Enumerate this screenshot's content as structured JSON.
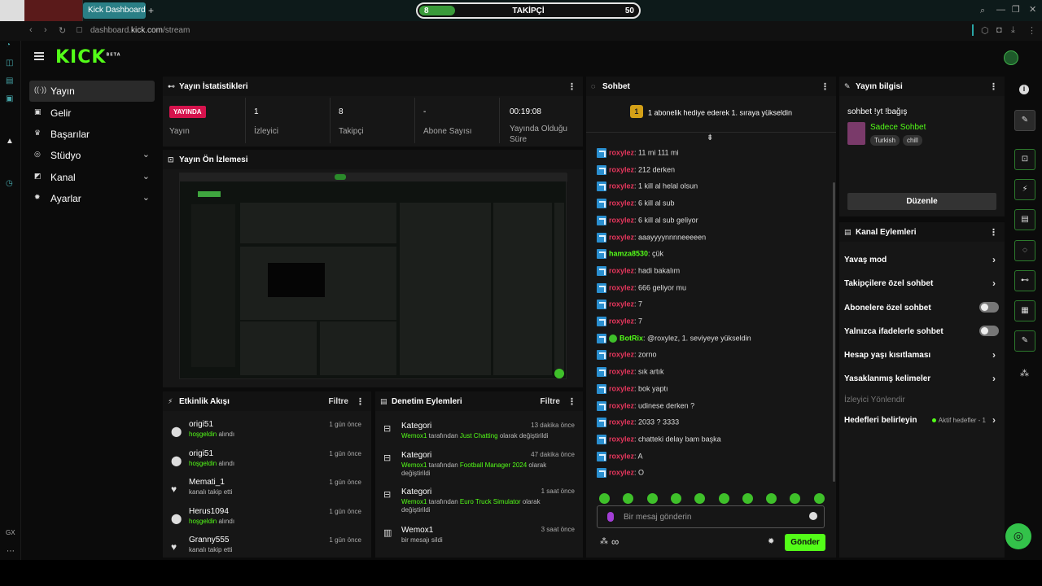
{
  "browser": {
    "tab_title": "Kick Dashboard",
    "url_prefix": "dashboard.",
    "url_domain": "kick.com",
    "url_path": "/stream"
  },
  "overlay": {
    "left_value": "8",
    "label": "TAKİPÇİ",
    "right_value": "50",
    "progress": 0.16
  },
  "header": {
    "logo": "KICK",
    "beta": "BETA"
  },
  "nav": [
    {
      "label": "Yayın",
      "icon": "broadcast-icon",
      "glyph": "((·))",
      "chev": ""
    },
    {
      "label": "Gelir",
      "icon": "wallet-icon",
      "glyph": "▣",
      "chev": ""
    },
    {
      "label": "Başarılar",
      "icon": "trophy-icon",
      "glyph": "♛",
      "chev": ""
    },
    {
      "label": "Stüdyo",
      "icon": "studio-icon",
      "glyph": "◎",
      "chev": "⌄"
    },
    {
      "label": "Kanal",
      "icon": "channel-icon",
      "glyph": "◩",
      "chev": "⌄"
    },
    {
      "label": "Ayarlar",
      "icon": "gear-icon",
      "glyph": "✹",
      "chev": "⌄"
    }
  ],
  "stats": {
    "title": "Yayın İstatistikleri",
    "live_badge": "YAYINDA",
    "items": [
      {
        "value": "",
        "label": "Yayın"
      },
      {
        "value": "1",
        "label": "İzleyici"
      },
      {
        "value": "8",
        "label": "Takipçi"
      },
      {
        "value": "-",
        "label": "Abone Sayısı"
      },
      {
        "value": "00:19:08",
        "label": "Yayında Olduğu Süre"
      }
    ]
  },
  "preview": {
    "title": "Yayın Ön İzlemesi"
  },
  "activity": {
    "title": "Etkinlik Akışı",
    "filter": "Filtre",
    "rows": [
      {
        "name": "origi51",
        "time": "1 gün önce",
        "sub_green": "hoşgeldin",
        "sub": " alındı",
        "icon": "gift-icon",
        "glyph": "⬤"
      },
      {
        "name": "origi51",
        "time": "1 gün önce",
        "sub_green": "hoşgeldin",
        "sub": " alındı",
        "icon": "gift-icon",
        "glyph": "⬤"
      },
      {
        "name": "Memati_1",
        "time": "1 gün önce",
        "sub_green": "",
        "sub": "kanalı takip etti",
        "icon": "heart-icon",
        "glyph": "♥"
      },
      {
        "name": "Herus1094",
        "time": "1 gün önce",
        "sub_green": "hoşgeldin",
        "sub": " alındı",
        "icon": "gift-icon",
        "glyph": "⬤"
      },
      {
        "name": "Granny555",
        "time": "1 gün önce",
        "sub_green": "",
        "sub": "kanalı takip etti",
        "icon": "heart-icon",
        "glyph": "♥"
      }
    ]
  },
  "moderation": {
    "title": "Denetim Eylemleri",
    "filter": "Filtre",
    "rows": [
      {
        "name": "Kategori",
        "time": "13 dakika önce",
        "user": "Wemox1",
        "mid": " tarafından ",
        "cat": "Just Chatting",
        "end": " olarak değiştirildi",
        "icon": "category-icon"
      },
      {
        "name": "Kategori",
        "time": "47 dakika önce",
        "user": "Wemox1",
        "mid": " tarafından ",
        "cat": "Football Manager 2024",
        "end": " olarak değiştirildi",
        "icon": "category-icon"
      },
      {
        "name": "Kategori",
        "time": "1 saat önce",
        "user": "Wemox1",
        "mid": " tarafından ",
        "cat": "Euro Truck Simulator",
        "end": " olarak değiştirildi",
        "icon": "category-icon"
      },
      {
        "name": "Wemox1",
        "time": "3 saat önce",
        "user": "",
        "mid": "bir mesajı sildi",
        "cat": "",
        "end": "",
        "icon": "trash-icon"
      }
    ]
  },
  "chat": {
    "title": "Sohbet",
    "pinned": "1 abonelik hediye ederek 1. sıraya yükseldin",
    "pinned_rank": "1",
    "messages": [
      {
        "user": "roxylez",
        "text": ": 11 mi 111 mi",
        "color": "#e8365d"
      },
      {
        "user": "roxylez",
        "text": ": 212 derken",
        "color": "#e8365d"
      },
      {
        "user": "roxylez",
        "text": ": 1 kill al helal olsun",
        "color": "#e8365d"
      },
      {
        "user": "roxylez",
        "text": ": 6 kill al sub",
        "color": "#e8365d"
      },
      {
        "user": "roxylez",
        "text": ": 6 kill al sub geliyor",
        "color": "#e8365d"
      },
      {
        "user": "roxylez",
        "text": ": aaayyyynnnneeeeen",
        "color": "#e8365d"
      },
      {
        "user": "hamza8530",
        "text": ": çük",
        "color": "#53fc18"
      },
      {
        "user": "roxylez",
        "text": ": hadi bakalım",
        "color": "#e8365d"
      },
      {
        "user": "roxylez",
        "text": ": 666 geliyor mu",
        "color": "#e8365d"
      },
      {
        "user": "roxylez",
        "text": ": 7",
        "color": "#e8365d"
      },
      {
        "user": "roxylez",
        "text": ": 7",
        "color": "#e8365d"
      },
      {
        "user": "BotRix",
        "text": ": @roxylez, 1. seviyeye yükseldin",
        "color": "#53fc18"
      },
      {
        "user": "roxylez",
        "text": ": zorno",
        "color": "#e8365d"
      },
      {
        "user": "roxylez",
        "text": ": sık artık",
        "color": "#e8365d"
      },
      {
        "user": "roxylez",
        "text": ": bok yaptı",
        "color": "#e8365d"
      },
      {
        "user": "roxylez",
        "text": ": udinese derken ?",
        "color": "#e8365d"
      },
      {
        "user": "roxylez",
        "text": ": 2033 ? 3333",
        "color": "#e8365d"
      },
      {
        "user": "roxylez",
        "text": ": chatteki delay bam başka",
        "color": "#e8365d"
      },
      {
        "user": "roxylez",
        "text": ": A",
        "color": "#e8365d"
      },
      {
        "user": "roxylez",
        "text": ": O",
        "color": "#e8365d"
      }
    ],
    "input_placeholder": "Bir mesaj gönderin",
    "send_label": "Gönder",
    "infinity": "∞"
  },
  "stream_info": {
    "title": "Yayın bilgisi",
    "stream_title": "sohbet !yt !bağış",
    "category": "Sadece Sohbet",
    "tags": [
      "Turkish",
      "chill"
    ],
    "edit_label": "Düzenle"
  },
  "channel_actions": {
    "title": "Kanal Eylemleri",
    "items": [
      {
        "label": "Yavaş mod",
        "control": "arrow"
      },
      {
        "label": "Takipçilere özel sohbet",
        "control": "arrow"
      },
      {
        "label": "Abonelere özel sohbet",
        "control": "toggle"
      },
      {
        "label": "Yalnızca ifadelerle sohbet",
        "control": "toggle"
      },
      {
        "label": "Hesap yaşı kısıtlaması",
        "control": "arrow"
      },
      {
        "label": "Yasaklanmış kelimeler",
        "control": "arrow"
      },
      {
        "label": "İzleyici Yönlendir",
        "control": "none"
      },
      {
        "label": "Hedefleri belirleyin",
        "control": "arrow",
        "extra": "Aktif hedefler - 1"
      }
    ]
  },
  "rail": {
    "gx_label": "GX"
  },
  "colors": {
    "accent": "#53fc18",
    "live": "#d6134d",
    "panel": "#161616"
  }
}
